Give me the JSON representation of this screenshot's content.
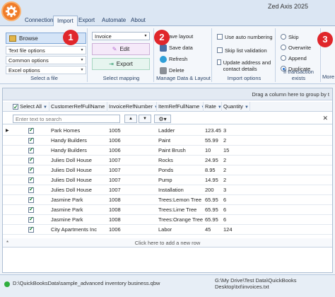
{
  "window": {
    "title": "Zed Axis 2025"
  },
  "tabs": [
    "Connection",
    "Import",
    "Export",
    "Automate",
    "About"
  ],
  "ribbon": {
    "select_file": {
      "browse_label": "Browse",
      "options": [
        "Text file options",
        "Common options",
        "Excel options"
      ],
      "group_label": "Select a file",
      "badge": "1"
    },
    "mapping": {
      "selected": "Invoice",
      "edit_label": "Edit",
      "export_label": "Export",
      "group_label": "Select mapping",
      "badge": "2"
    },
    "manage": {
      "save_layout": "Save layout",
      "save_data": "Save data",
      "refresh": "Refresh",
      "delete": "Delete",
      "group_label": "Manage Data & Layout"
    },
    "import_options": {
      "auto_numbering": "Use auto numbering",
      "skip_list_validation": "Skip list validation",
      "update_address": "Update address and contact details",
      "group_label": "Import options"
    },
    "if_exists": {
      "options": [
        "Skip",
        "Overwrite",
        "Append",
        "Duplicate"
      ],
      "selected_index": 3,
      "group_label": "If transaction exists",
      "badge": "3",
      "more_label": "More"
    }
  },
  "grid": {
    "group_hint": "Drag a column here to group by t",
    "columns": [
      "Select All",
      "CustomerRefFullName",
      "InvoiceRefNumber",
      "ItemRefFullName",
      "Rate",
      "Quantity"
    ],
    "search_placeholder": "Enter text to search",
    "rows": [
      [
        "Park Homes",
        "1005",
        "Ladder",
        "123.45",
        "3"
      ],
      [
        "Handy Builders",
        "1006",
        "Paint",
        "55.99",
        "2"
      ],
      [
        "Handy Builders",
        "1006",
        "Paint Brush",
        "10",
        "15"
      ],
      [
        "Julies Doll House",
        "1007",
        "Rocks",
        "24.95",
        "2"
      ],
      [
        "Julies Doll House",
        "1007",
        "Ponds",
        "8.95",
        "2"
      ],
      [
        "Julies Doll House",
        "1007",
        "Pump",
        "14.95",
        "2"
      ],
      [
        "Julies Doll House",
        "1007",
        "Installation",
        "200",
        "3"
      ],
      [
        "Jasmine Park",
        "1008",
        "Trees:Lemon Tree",
        "65.95",
        "6"
      ],
      [
        "Jasmine Park",
        "1008",
        "Trees:Lime Tree",
        "65.95",
        "6"
      ],
      [
        "Jasmine Park",
        "1008",
        "Trees:Orange Tree",
        "65.95",
        "6"
      ],
      [
        "City Apartments Inc",
        "1006",
        "Labor",
        "45",
        "124"
      ]
    ],
    "add_row_label": "Click here to add a new row"
  },
  "status": {
    "left_path": "D:\\QuickBooksData\\sample_advanced inventory business.qbw",
    "right_path": "G:\\My Drive\\Test Data\\QuickBooks Desktop\\txt\\invoices.txt"
  }
}
